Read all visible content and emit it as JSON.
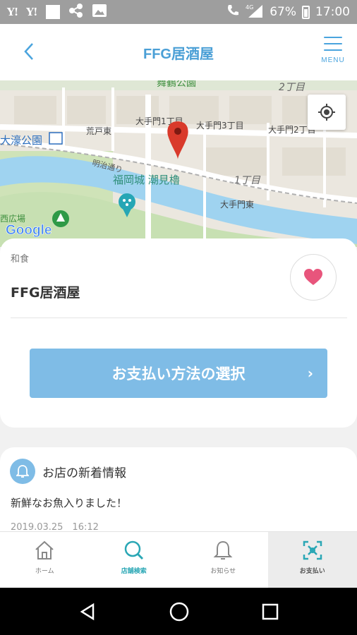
{
  "status_bar": {
    "carrier_icons": [
      "Y!",
      "Y!"
    ],
    "network": "4G",
    "battery": "67%",
    "time": "17:00"
  },
  "header": {
    "title": "FFG居酒屋",
    "menu_label": "MENU",
    "back_icon": "chevron-left-icon",
    "menu_icon": "hamburger-icon"
  },
  "map": {
    "labels": {
      "park_top": "舞鶴公園",
      "block_2": "2丁目",
      "ohori_park": "大濠公園",
      "arato_higashi": "荒戸東",
      "otemon_1": "大手門1丁目",
      "otemon_3": "大手門3丁目",
      "otemon_2": "大手門2丁目",
      "meiji_dori": "明治通り",
      "shiomi_yagura": "福岡城 潮見櫓",
      "block_1": "1丁目",
      "otemon_higashi": "大手門東",
      "plaza": "西広場",
      "google": "Google"
    }
  },
  "store": {
    "category": "和食",
    "name": "FFG居酒屋",
    "pay_button": "お支払い方法の選択",
    "pay_arrow": "›"
  },
  "news": {
    "title": "お店の新着情報",
    "body": "新鮮なお魚入りました！",
    "date": "2019.03.25　16:12"
  },
  "bottom_nav": [
    {
      "label": "ホーム",
      "icon": "home-icon"
    },
    {
      "label": "店舗検索",
      "icon": "search-icon"
    },
    {
      "label": "お知らせ",
      "icon": "bell-icon"
    },
    {
      "label": "お支払い",
      "icon": "qr-scan-icon"
    }
  ],
  "colors": {
    "accent": "#4a9fd6",
    "pay_button": "#7fbce6",
    "heart": "#e8557c",
    "search_active": "#2aa7b5"
  }
}
